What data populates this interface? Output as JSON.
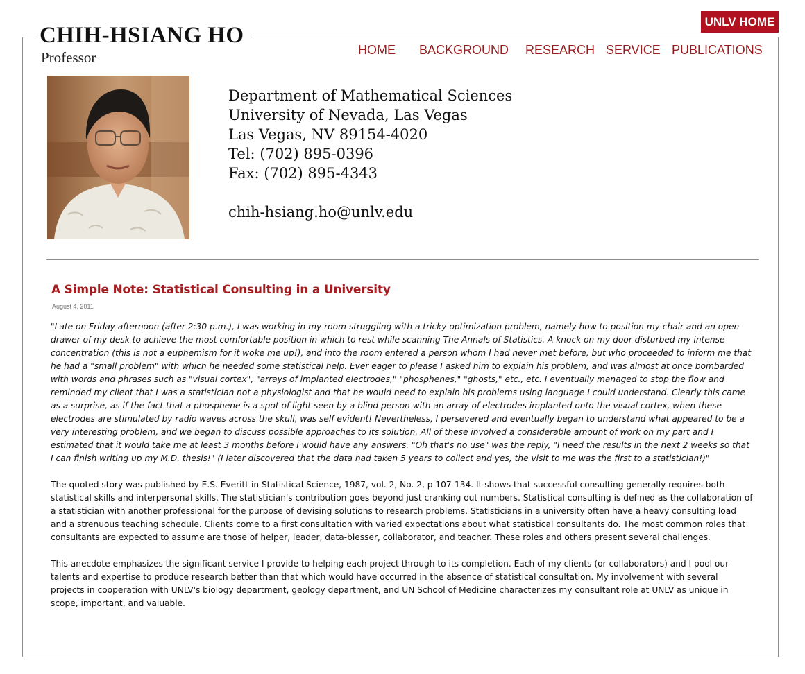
{
  "header": {
    "unlv_home_label": "UNLV HOME",
    "name": "CHIH-HSIANG HO",
    "rank": "Professor"
  },
  "nav": {
    "items": [
      {
        "label": "HOME"
      },
      {
        "label": "BACKGROUND"
      },
      {
        "label": "RESEARCH"
      },
      {
        "label": "SERVICE"
      },
      {
        "label": "PUBLICATIONS"
      }
    ]
  },
  "contact": {
    "department": "Department of Mathematical Sciences",
    "university": "University of Nevada, Las Vegas",
    "city": "Las Vegas, NV 89154-4020",
    "tel": "Tel: (702) 895-0396",
    "fax": "Fax: (702) 895-4343",
    "email": "chih-hsiang.ho@unlv.edu"
  },
  "post": {
    "title": "A Simple Note: Statistical Consulting in a University",
    "date": "August 4, 2011",
    "quote": "\"Late on Friday afternoon (after 2:30 p.m.), I was working in my room struggling with a tricky optimization problem, namely how to position my chair and an open drawer of my desk to achieve the most comfortable position in which to rest while scanning The Annals of Statistics. A knock on my door disturbed my intense concentration (this is not a euphemism for it woke me up!), and into the room entered a person whom I had never met before, but who proceeded to inform me that he had a \"small problem\" with which he needed some statistical help. Ever eager to please I asked him to explain his problem, and was almost at once bombarded with words and phrases such as \"visual cortex\", \"arrays of implanted electrodes,\" \"phosphenes,\" \"ghosts,\" etc., etc. I eventually managed to stop the flow and reminded my client that I was a statistician not a physiologist and that he would need to explain his problems using language I could understand. Clearly this came as a surprise, as if the fact that a phosphene is a spot of light seen by a blind person with an array of electrodes implanted onto the visual cortex, when these electrodes are stimulated by radio waves across the skull, was self evident! Nevertheless, I persevered and eventually began to understand what appeared to be a very interesting problem, and we began to discuss possible approaches to its solution. All of these involved a considerable amount of work on my part and I estimated that it would take me at least 3 months before I would have any answers. \"Oh that's no use\" was the reply, \"I need the results in the next 2 weeks so that I can finish writing up my M.D. thesis!\" (I later discovered that the data had taken 5 years to collect and yes, the visit to me was the first to a statistician!)\"",
    "paragraph_2": "The quoted story was published by E.S. Everitt in Statistical Science, 1987, vol. 2, No. 2, p 107-134. It shows that successful consulting generally requires both statistical skills and interpersonal skills. The statistician's contribution goes beyond just cranking out numbers. Statistical consulting is defined as the collaboration of a statistician with another professional for the purpose of devising solutions to research problems. Statisticians in a university often have a heavy consulting load and a strenuous teaching schedule. Clients come to a first consultation with varied expectations about what statistical consultants do. The most common roles that consultants are expected to assume are those of helper, leader, data-blesser, collaborator, and teacher. These roles and others present several challenges.",
    "paragraph_3": "This anecdote emphasizes the significant service I provide to helping each project through to its completion. Each of my clients (or collaborators) and I pool our talents and expertise to produce research better than that which would have occurred in the absence of statistical consultation. My involvement with several projects in cooperation with UNLV's biology department, geology department, and UN School of Medicine characterizes my consultant role at UNLV as unique in scope, important, and valuable."
  },
  "colors": {
    "accent": "#b1121f",
    "nav_text": "#9b1b1f",
    "title_text": "#a51c20"
  }
}
